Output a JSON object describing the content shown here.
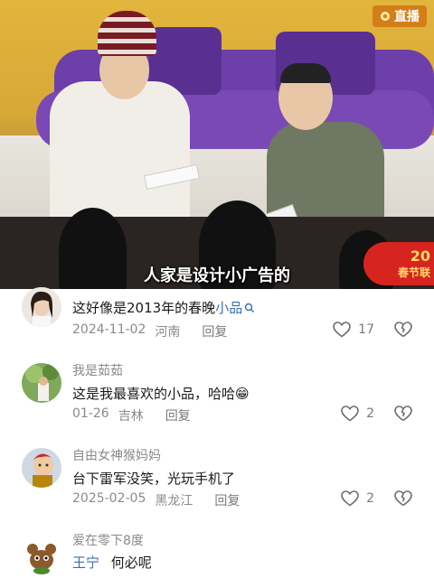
{
  "video": {
    "live_label": "直播",
    "subtitle": "人家是设计小广告的",
    "logo": {
      "year": "20",
      "name": "春节联"
    }
  },
  "comments": [
    {
      "user": "",
      "text": "这好像是2013年的春晚",
      "highlight": "小品",
      "date": "2024-11-02",
      "location": "河南",
      "reply_label": "回复",
      "likes": "17"
    },
    {
      "user": "我是茹茹",
      "text": "这是我最喜欢的小品，哈哈😁",
      "highlight": "",
      "date": "01-26",
      "location": "吉林",
      "reply_label": "回复",
      "likes": "2"
    },
    {
      "user": "自由女神猴妈妈",
      "text": "台下雷军没笑，光玩手机了",
      "highlight": "",
      "date": "2025-02-05",
      "location": "黑龙江",
      "reply_label": "回复",
      "likes": "2"
    },
    {
      "user": "爱在零下8度",
      "mention": "王宁",
      "text": "何必呢",
      "highlight": ""
    }
  ],
  "colors": {
    "mention": "#3a6fb0",
    "muted": "#8a8a8a",
    "text": "#1a1a1a"
  }
}
